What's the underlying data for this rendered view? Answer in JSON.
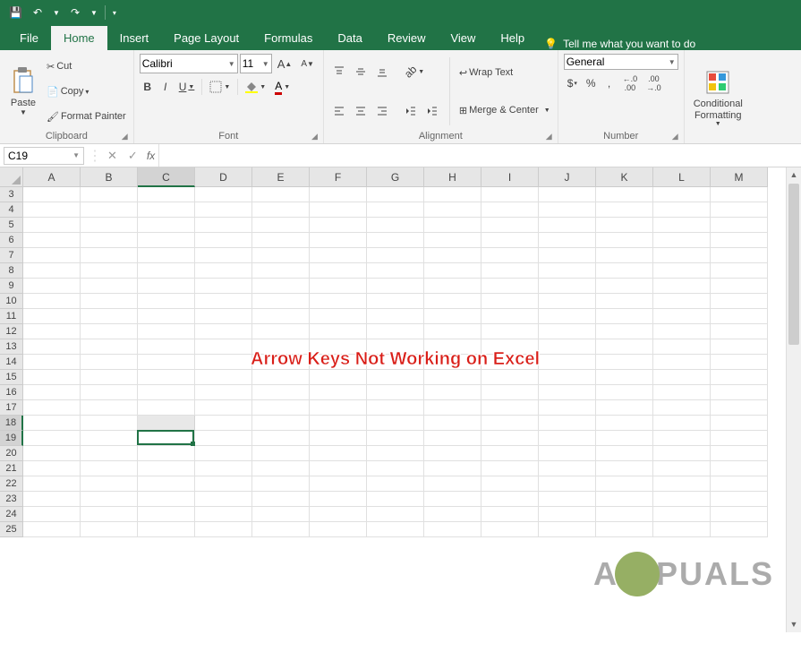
{
  "qat": {
    "save": "💾",
    "undo": "↶",
    "redo": "↷",
    "customize": "▾"
  },
  "tabs": [
    "File",
    "Home",
    "Insert",
    "Page Layout",
    "Formulas",
    "Data",
    "Review",
    "View",
    "Help"
  ],
  "active_tab": "Home",
  "tell_me": "Tell me what you want to do",
  "ribbon": {
    "clipboard": {
      "label": "Clipboard",
      "paste": "Paste",
      "cut": "Cut",
      "copy": "Copy",
      "format_painter": "Format Painter"
    },
    "font": {
      "label": "Font",
      "name": "Calibri",
      "size": "11",
      "bold": "B",
      "italic": "I",
      "underline": "U",
      "increase": "A",
      "decrease": "A"
    },
    "alignment": {
      "label": "Alignment",
      "wrap": "Wrap Text",
      "merge": "Merge & Center"
    },
    "number": {
      "label": "Number",
      "format": "General",
      "currency": "$",
      "percent": "%",
      "comma": ",",
      "inc_dec": ".0",
      "dec_dec": ".00"
    },
    "styles": {
      "cond": "Conditional\nFormatting"
    }
  },
  "name_box": "C19",
  "columns": [
    "A",
    "B",
    "C",
    "D",
    "E",
    "F",
    "G",
    "H",
    "I",
    "J",
    "K",
    "L",
    "M"
  ],
  "rows": [
    "3",
    "4",
    "5",
    "6",
    "7",
    "8",
    "9",
    "10",
    "11",
    "12",
    "13",
    "14",
    "15",
    "16",
    "17",
    "18",
    "19",
    "20",
    "21",
    "22",
    "23",
    "24",
    "25"
  ],
  "selected_col": "C",
  "selected_rows": [
    "18",
    "19"
  ],
  "active_cell_ref": "C19",
  "overlay": "Arrow Keys Not Working on Excel",
  "watermark": "A  PUALS"
}
